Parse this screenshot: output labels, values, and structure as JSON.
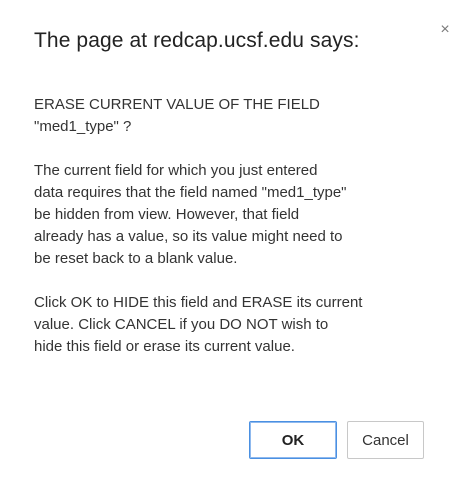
{
  "dialog": {
    "title": "The page at redcap.ucsf.edu says:",
    "close_glyph": "×",
    "close_icon": "close-icon",
    "message": [
      "ERASE CURRENT VALUE OF THE FIELD\n\"med1_type\" ?",
      "The current field for which you just entered\ndata requires that the field named \"med1_type\"\nbe hidden from view. However, that field\nalready has a value, so its value might need to\nbe reset back to a blank value.",
      "Click OK to HIDE this field and ERASE its current\nvalue. Click CANCEL if you DO NOT wish to\nhide this field or erase its current value."
    ],
    "ok_label": "OK",
    "cancel_label": "Cancel"
  },
  "colors": {
    "focus_border": "#4a90e2",
    "text": "#333333"
  }
}
